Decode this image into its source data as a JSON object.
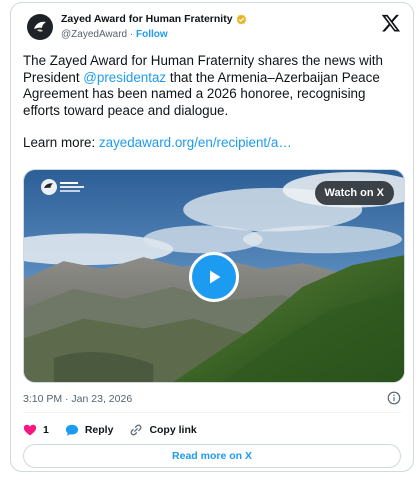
{
  "tweet": {
    "display_name": "Zayed Award for Human Fraternity",
    "handle": "@ZayedAward",
    "separator": " · ",
    "follow_label": "Follow",
    "text_part1": "The Zayed Award for Human Fraternity shares the news with President ",
    "mention": "@presidentaz",
    "text_part2": "  that the Armenia–Azerbaijan Peace Agreement has been named a 2026 honoree, recognising efforts toward peace and dialogue.",
    "learn_more_label": "Learn more: ",
    "learn_more_link": "zayedaward.org/en/recipient/a…",
    "timestamp": "3:10 PM · Jan 23, 2026"
  },
  "media": {
    "watch_label": "Watch on X"
  },
  "actions": {
    "like_count": "1",
    "reply_label": "Reply",
    "copy_link_label": "Copy link"
  },
  "footer": {
    "read_more_label": "Read more on X"
  },
  "icons": {
    "verified": "verified-badge-icon",
    "x_logo": "x-logo-icon",
    "heart": "heart-icon",
    "reply": "reply-bubble-icon",
    "link": "link-icon",
    "info": "info-icon",
    "play": "play-icon"
  },
  "colors": {
    "accent": "#1d9bf0",
    "heart": "#f91880",
    "verified": "#e8b424",
    "text": "#0f1419",
    "muted": "#536471"
  }
}
